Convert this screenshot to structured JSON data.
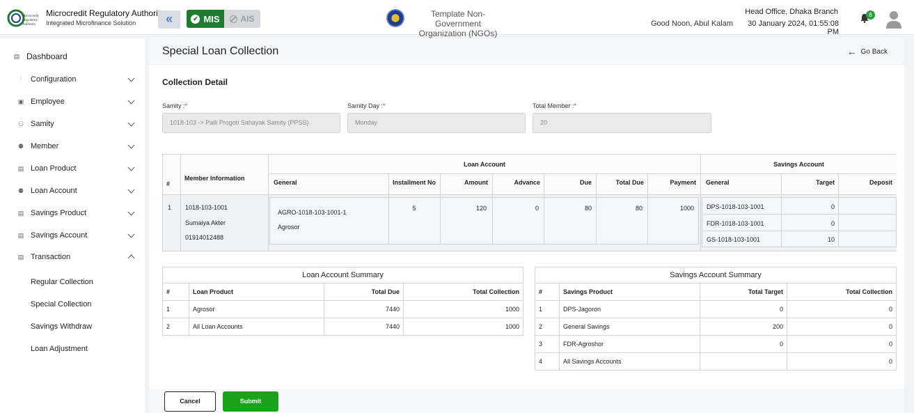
{
  "header": {
    "logo_text": "Microcredit Regulatory Authority",
    "org_name": "Microcredit Regulatory Authority",
    "org_sub": "Integrated Microfinance Solution",
    "mis_label": "MIS",
    "ais_label": "AIS",
    "ngo_name": "Template Non-Government Organization (NGOs)",
    "greeting": "Good Noon, Abul Kalam",
    "branch": "Head Office, Dhaka Branch",
    "datetime": "30 January 2024, 01:55:08 PM",
    "notification_count": "8",
    "accent": "#1f7a32"
  },
  "sidebar": {
    "dashboard": "Dashboard",
    "items": [
      {
        "label": "Configuration",
        "icon": "sliders-icon"
      },
      {
        "label": "Employee",
        "icon": "id-card-icon"
      },
      {
        "label": "Samity",
        "icon": "group-icon"
      },
      {
        "label": "Member",
        "icon": "users-icon"
      },
      {
        "label": "Loan Product",
        "icon": "document-icon"
      },
      {
        "label": "Loan Account",
        "icon": "users-icon"
      },
      {
        "label": "Savings Product",
        "icon": "document-icon"
      },
      {
        "label": "Savings Account",
        "icon": "document-icon"
      },
      {
        "label": "Transaction",
        "icon": "document-icon"
      }
    ],
    "transaction_sub": [
      "Regular Collection",
      "Special Collection",
      "Savings Withdraw",
      "Loan Adjustment"
    ]
  },
  "main": {
    "title": "Special Loan Collection",
    "go_back": "Go Back",
    "section": "Collection Detail",
    "fields": {
      "samity_label": "Samity :",
      "samity_value": "1018-103 -> Palli Progoti Sahayak Samity (PPSS)",
      "day_label": "Samity Day :",
      "day_value": "Monday",
      "member_label": "Total Member :",
      "member_value": "20",
      "required_mark": "*"
    }
  },
  "collection": {
    "headers": {
      "hash": "#",
      "member_info": "Member Information",
      "loan_account": "Loan Account",
      "savings_account": "Savings Account",
      "general": "General",
      "installment_no": "Installment No",
      "amount": "Amount",
      "advance": "Advance",
      "due": "Due",
      "total_due": "Total Due",
      "payment": "Payment",
      "s_general": "General",
      "target": "Target",
      "deposit": "Deposit"
    },
    "row": {
      "no": "1",
      "member_code": "1018-103-1001",
      "member_name": "Sumaiya Akter",
      "phone": "01914012488",
      "loan_code": "AGRO-1018-103-1001-1",
      "loan_product": "Agrosor",
      "installment_no": "5",
      "amount": "120",
      "advance": "0",
      "due": "80",
      "total_due": "80",
      "payment": "1000",
      "savings": [
        {
          "general": "DPS-1018-103-1001",
          "target": "0",
          "deposit": ""
        },
        {
          "general": "FDR-1018-103-1001",
          "target": "0",
          "deposit": ""
        },
        {
          "general": "GS-1018-103-1001",
          "target": "10",
          "deposit": ""
        }
      ]
    }
  },
  "loan_summary": {
    "caption": "Loan Account Summary",
    "headers": [
      "#",
      "Loan Product",
      "Total Due",
      "Total Collection"
    ],
    "rows": [
      [
        "1",
        "Agrosor",
        "7440",
        "1000"
      ],
      [
        "2",
        "All Loan Accounts",
        "7440",
        "1000"
      ]
    ]
  },
  "savings_summary": {
    "caption": "Savings Account Summary",
    "headers": [
      "#",
      "Savings Product",
      "Total Target",
      "Total Collection"
    ],
    "rows": [
      [
        "1",
        "DPS-Jagoron",
        "0",
        "0"
      ],
      [
        "2",
        "General Savings",
        "200",
        "0"
      ],
      [
        "3",
        "FDR-Agroshor",
        "0",
        "0"
      ],
      [
        "4",
        "All Savings Accounts",
        "",
        "0"
      ]
    ]
  },
  "buttons": {
    "cancel": "Cancel",
    "submit": "Submit"
  }
}
